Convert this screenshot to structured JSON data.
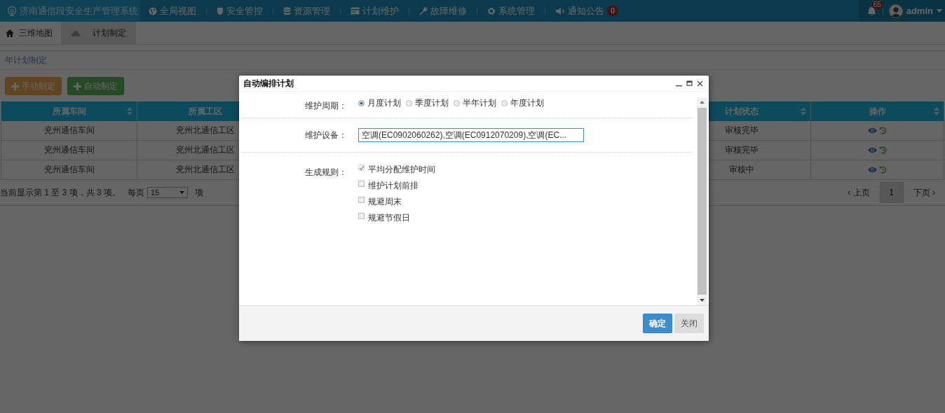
{
  "app_title": "济南通信段安全生产管理系统",
  "nav": [
    {
      "label": "全局视图"
    },
    {
      "label": "安全管控"
    },
    {
      "label": "资源管理"
    },
    {
      "label": "计划维护"
    },
    {
      "label": "故障维修"
    },
    {
      "label": "系统管理"
    },
    {
      "label": "通知公告",
      "badge": "0"
    }
  ],
  "notifications": {
    "badge": "65"
  },
  "user": {
    "name": "admin"
  },
  "tabs": [
    {
      "label": "三维地图",
      "selected": false
    },
    {
      "label": "计划制定",
      "selected": true
    }
  ],
  "breadcrumb": "年计划制定",
  "actions": [
    {
      "label": "手动制定",
      "kind": "warning"
    },
    {
      "label": "自动制定",
      "kind": "success"
    }
  ],
  "table": {
    "columns": [
      {
        "label": "所属车间",
        "sortable": true
      },
      {
        "label": "所属工区"
      },
      {
        "label": "计划状态",
        "sortable": true
      },
      {
        "label": "操作",
        "sortable": true
      }
    ],
    "rows": [
      {
        "cells": [
          "兖州通信车间",
          "兖州北通信工区",
          "审核完毕"
        ]
      },
      {
        "cells": [
          "兖州通信车间",
          "兖州北通信工区",
          "审核完毕"
        ]
      },
      {
        "cells": [
          "兖州通信车间",
          "兖州北通信工区",
          "审核中"
        ]
      }
    ]
  },
  "pager": {
    "summary": "当前显示第 1 至 3 项，共 3 项。",
    "per_page": "每页",
    "page_size": "15",
    "unit": "项",
    "prev": "‹ 上页",
    "pages": [
      {
        "label": "1",
        "selected": true
      }
    ],
    "next": "下页 ›"
  },
  "dialog": {
    "title": "自动编排计划",
    "fields": [
      {
        "kind": "radio",
        "label": "维护周期：",
        "options": [
          {
            "label": "月度计划",
            "selected": true
          },
          {
            "label": "季度计划",
            "selected": false
          },
          {
            "label": "半年计划",
            "selected": false
          },
          {
            "label": "年度计划",
            "selected": false
          }
        ]
      },
      {
        "kind": "text",
        "label": "维护设备：",
        "value": "空调(EC0902060262),空调(EC0912070209),空调(EC..."
      },
      {
        "kind": "checkbox",
        "label": "生成规则：",
        "options": [
          {
            "label": "平均分配维护时间",
            "checked": true,
            "disabled": true
          },
          {
            "label": "维护计划前排",
            "checked": false,
            "disabled": false
          },
          {
            "label": "规避周末",
            "checked": false,
            "disabled": false
          },
          {
            "label": "规避节假日",
            "checked": false,
            "disabled": false
          }
        ]
      }
    ],
    "buttons": [
      {
        "label": "确定",
        "kind": "primary"
      },
      {
        "label": "关闭",
        "kind": "default"
      }
    ]
  }
}
